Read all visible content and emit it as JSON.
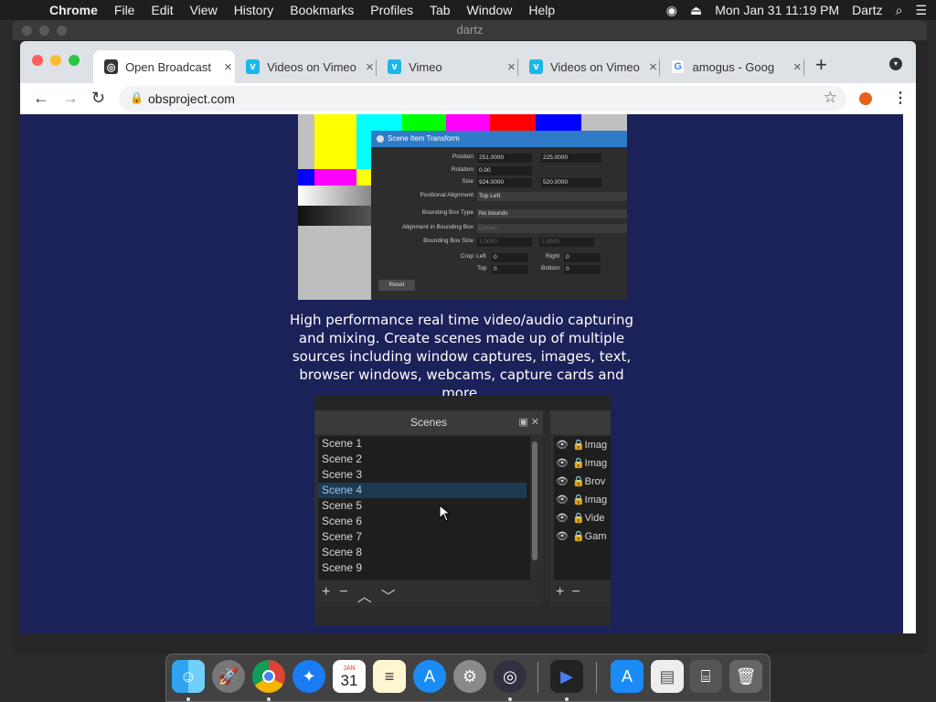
{
  "menubar": {
    "app_name": "Chrome",
    "menus": [
      "File",
      "Edit",
      "View",
      "History",
      "Bookmarks",
      "Profiles",
      "Tab",
      "Window",
      "Help"
    ],
    "datetime": "Mon Jan 31  11:19 PM",
    "user": "Dartz"
  },
  "background_window": {
    "title": "dartz"
  },
  "browser": {
    "tabs": [
      {
        "title": "Open Broadcast",
        "favicon": "obs-icon",
        "active": true
      },
      {
        "title": "Videos on Vimeo",
        "favicon": "vimeo-icon",
        "active": false
      },
      {
        "title": "Vimeo",
        "favicon": "vimeo-icon",
        "active": false
      },
      {
        "title": "Videos on Vimeo",
        "favicon": "vimeo-icon",
        "active": false
      },
      {
        "title": "amogus - Goog",
        "favicon": "google-icon",
        "active": false
      }
    ],
    "url": "obsproject.com"
  },
  "page": {
    "transform_dialog": {
      "title": "Scene Item Transform",
      "position_label": "Position",
      "position_x": "251.0000",
      "position_y": "225.0000",
      "rotation_label": "Rotation",
      "rotation": "0.00",
      "size_label": "Size",
      "size_w": "924.0000",
      "size_h": "520.0000",
      "alignment_label": "Positional Alignment",
      "alignment": "Top Left",
      "bbox_type_label": "Bounding Box Type",
      "bbox_type": "No bounds",
      "bbox_align_label": "Alignment in Bounding Box",
      "bbox_align": "Center",
      "bbox_size_label": "Bounding Box Size",
      "bbox_w": "1.0000",
      "bbox_h": "1.0000",
      "crop_label": "Crop",
      "left_label": "Left",
      "left": "0",
      "right_label": "Right",
      "right": "0",
      "top_label": "Top",
      "top": "0",
      "bottom_label": "Bottom",
      "bottom": "0",
      "reset": "Reset"
    },
    "caption": "High performance real time video/audio capturing and mixing. Create scenes made up of multiple sources including window captures, images, text, browser windows, webcams, capture cards and more.",
    "scenes_dock": {
      "title": "Scenes",
      "scenes": [
        "Scene 1",
        "Scene 2",
        "Scene 3",
        "Scene 4",
        "Scene 5",
        "Scene 6",
        "Scene 7",
        "Scene 8",
        "Scene 9"
      ],
      "selected_index": 3,
      "sources": [
        "Imag",
        "Imag",
        "Brov",
        "Imag",
        "Vide",
        "Gam"
      ]
    }
  },
  "colors": {
    "page_bg": "#1b2159",
    "selected_scene": "#1e3a52",
    "bar_colors": [
      "#ffff00",
      "#00ffff",
      "#00ff00",
      "#ff00ff",
      "#ff0000",
      "#0000ff"
    ]
  },
  "dock": {
    "apps": [
      "finder-icon",
      "launchpad-icon",
      "chrome-icon",
      "safari-icon",
      "calendar-icon",
      "notes-icon",
      "app-store-icon",
      "system-preferences-icon",
      "obs-icon",
      "video-app-icon",
      "app-store-downloads-icon",
      "documents-icon",
      "preview-icon",
      "trash-icon"
    ],
    "calendar_month": "JAN",
    "calendar_day": "31"
  }
}
